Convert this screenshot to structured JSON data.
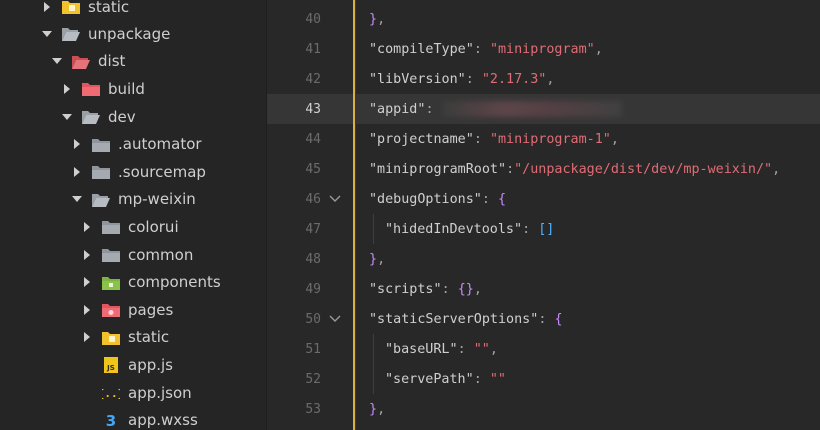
{
  "explorer": {
    "rows": [
      {
        "label": "static",
        "icon": "folder-yellow-icon",
        "expanded": false
      },
      {
        "label": "unpackage",
        "icon": "folder-open-icon",
        "expanded": true
      },
      {
        "label": "dist",
        "icon": "folder-red-open-icon",
        "expanded": true
      },
      {
        "label": "build",
        "icon": "folder-red-icon",
        "expanded": false
      },
      {
        "label": "dev",
        "icon": "folder-open-icon",
        "expanded": true
      },
      {
        "label": ".automator",
        "icon": "folder-icon",
        "expanded": false
      },
      {
        "label": ".sourcemap",
        "icon": "folder-icon",
        "expanded": false
      },
      {
        "label": "mp-weixin",
        "icon": "folder-open-icon",
        "expanded": true
      },
      {
        "label": "colorui",
        "icon": "folder-icon",
        "expanded": false
      },
      {
        "label": "common",
        "icon": "folder-icon",
        "expanded": false
      },
      {
        "label": "components",
        "icon": "folder-green-icon",
        "expanded": false
      },
      {
        "label": "pages",
        "icon": "folder-red-icon",
        "expanded": false
      },
      {
        "label": "static",
        "icon": "folder-yellow-icon",
        "expanded": false
      },
      {
        "label": "app.js",
        "icon": "js-file-icon",
        "expanded": null
      },
      {
        "label": "app.json",
        "icon": "json-file-icon",
        "expanded": null
      },
      {
        "label": "app.wxss",
        "icon": "css-file-icon",
        "expanded": null
      }
    ]
  },
  "editor": {
    "current_line": "43",
    "lines": [
      {
        "n": "40",
        "text": "},"
      },
      {
        "n": "41",
        "text": "\"compileType\": \"miniprogram\","
      },
      {
        "n": "42",
        "text": "\"libVersion\": \"2.17.3\","
      },
      {
        "n": "43",
        "text": "\"appid\":"
      },
      {
        "n": "44",
        "text": "\"projectname\": \"miniprogram-1\","
      },
      {
        "n": "45",
        "text": "\"miniprogramRoot\":\"/unpackage/dist/dev/mp-weixin/\","
      },
      {
        "n": "46",
        "text": "\"debugOptions\": {"
      },
      {
        "n": "47",
        "text": "\"hidedInDevtools\": []"
      },
      {
        "n": "48",
        "text": "},"
      },
      {
        "n": "49",
        "text": "\"scripts\": {},"
      },
      {
        "n": "50",
        "text": "\"staticServerOptions\": {"
      },
      {
        "n": "51",
        "text": "\"baseURL\": \"\","
      },
      {
        "n": "52",
        "text": "\"servePath\": \"\""
      },
      {
        "n": "53",
        "text": "},"
      }
    ]
  },
  "colors": {
    "background": "#282828",
    "sidebar": "#252526",
    "string": "#e06c75",
    "brace": "#c58af9",
    "active_line": "#363636",
    "edge_accent": "#d7b23c"
  }
}
